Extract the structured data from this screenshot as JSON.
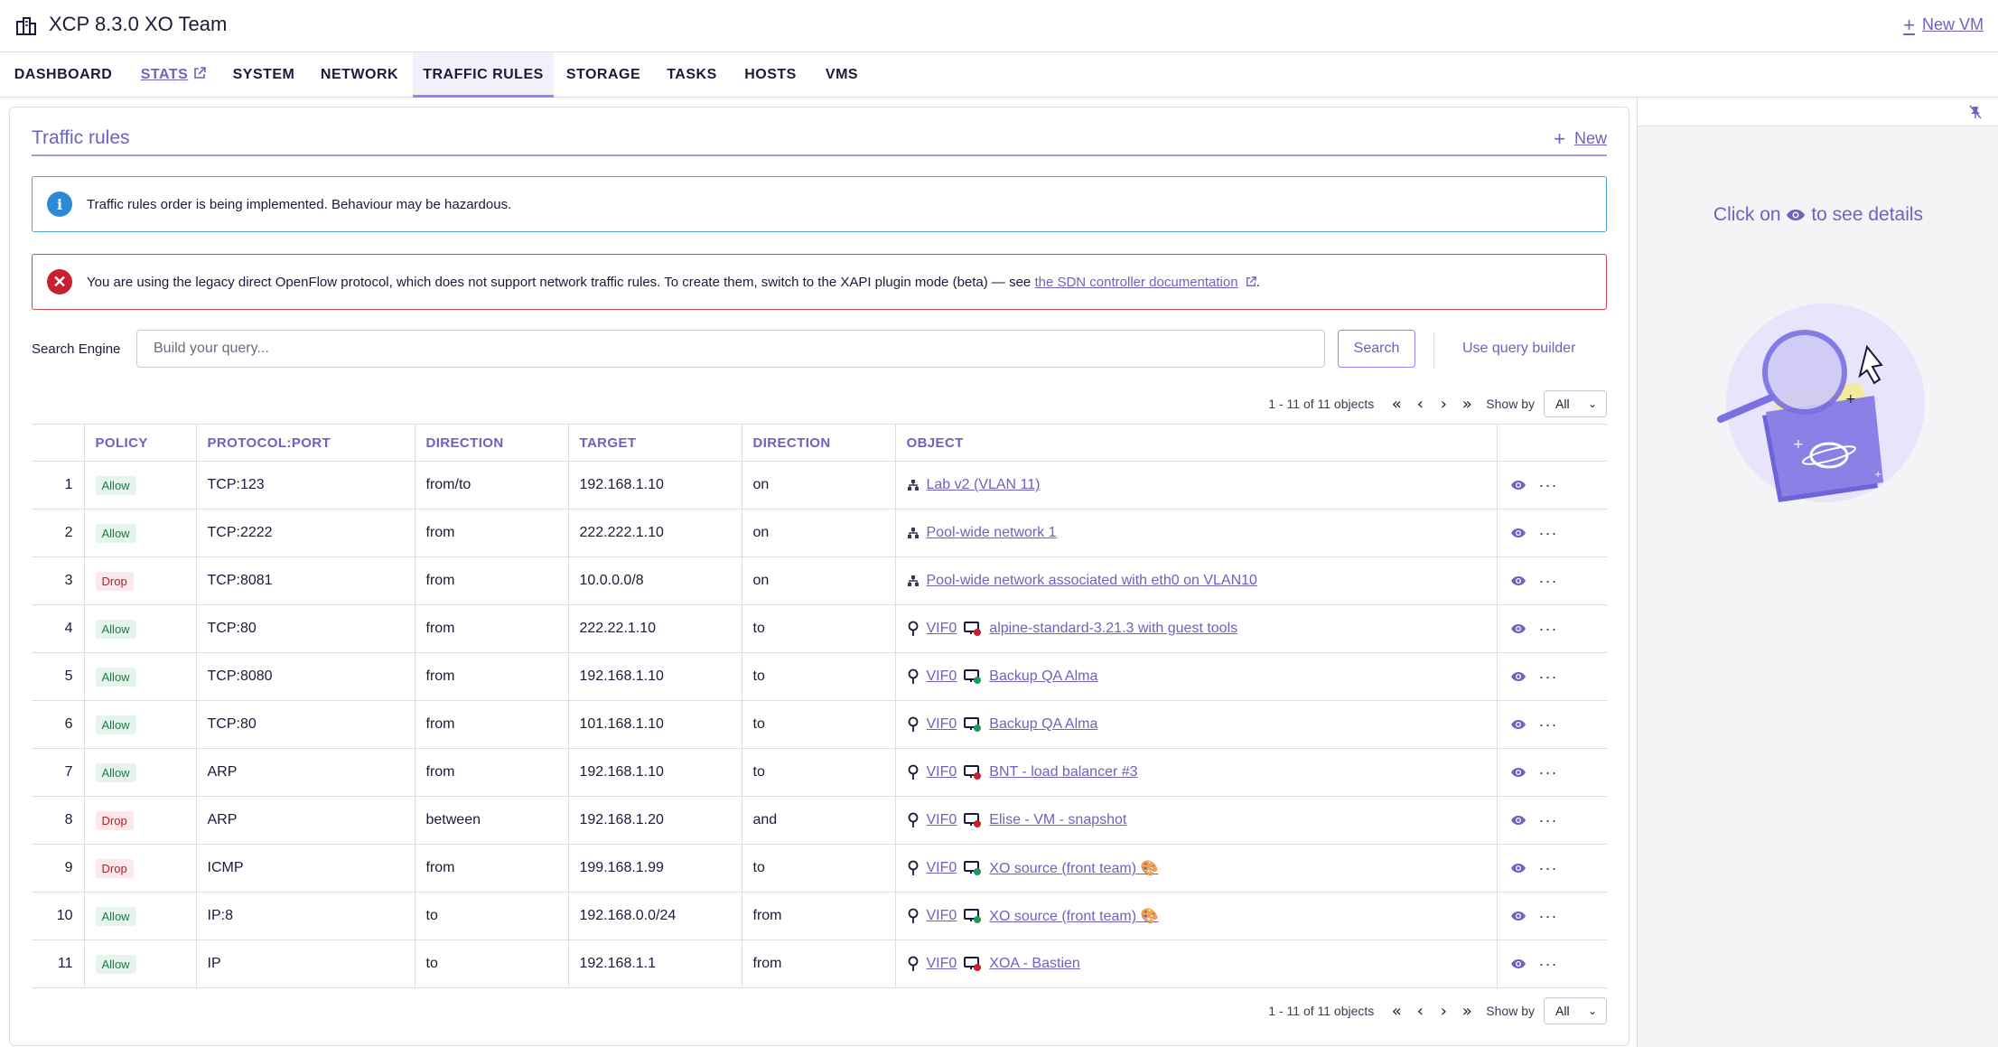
{
  "header": {
    "title": "XCP 8.3.0 XO Team",
    "new_vm": "New VM"
  },
  "tabs": [
    {
      "label": "DASHBOARD"
    },
    {
      "label": "STATS"
    },
    {
      "label": "SYSTEM"
    },
    {
      "label": "NETWORK"
    },
    {
      "label": "TRAFFIC RULES"
    },
    {
      "label": "STORAGE"
    },
    {
      "label": "TASKS"
    },
    {
      "label": "HOSTS"
    },
    {
      "label": "VMS"
    }
  ],
  "section": {
    "title": "Traffic rules",
    "new_label": "New"
  },
  "alerts": {
    "info": "Traffic rules order is being implemented. Behaviour may be hazardous.",
    "danger_text": "You are using the legacy direct OpenFlow protocol, which does not support network traffic rules. To create them, switch to the XAPI plugin mode (beta) — see",
    "danger_link": "the SDN controller documentation",
    "danger_end": "."
  },
  "search": {
    "label": "Search Engine",
    "placeholder": "Build your query...",
    "button": "Search",
    "query_builder": "Use query builder"
  },
  "pagination": {
    "count": "1 - 11 of 11 objects",
    "show_by_label": "Show by",
    "show_by_value": "All"
  },
  "table": {
    "columns": [
      "",
      "POLICY",
      "PROTOCOL:PORT",
      "DIRECTION",
      "TARGET",
      "DIRECTION",
      "OBJECT",
      ""
    ],
    "rows": [
      {
        "n": "1",
        "policy": "Allow",
        "proto": "TCP:123",
        "dir": "from/to",
        "target": "192.168.1.10",
        "dir2": "on",
        "obj_type": "network",
        "obj": "Lab v2 (VLAN 11)"
      },
      {
        "n": "2",
        "policy": "Allow",
        "proto": "TCP:2222",
        "dir": "from",
        "target": "222.222.1.10",
        "dir2": "on",
        "obj_type": "network",
        "obj": "Pool-wide network 1"
      },
      {
        "n": "3",
        "policy": "Drop",
        "proto": "TCP:8081",
        "dir": "from",
        "target": "10.0.0.0/8",
        "dir2": "on",
        "obj_type": "network",
        "obj": "Pool-wide network associated with eth0 on VLAN10"
      },
      {
        "n": "4",
        "policy": "Allow",
        "proto": "TCP:80",
        "dir": "from",
        "target": "222.22.1.10",
        "dir2": "to",
        "obj_type": "vif",
        "vif": "VIF0",
        "vm_state": "halted",
        "obj": "alpine-standard-3.21.3 with guest tools"
      },
      {
        "n": "5",
        "policy": "Allow",
        "proto": "TCP:8080",
        "dir": "from",
        "target": "192.168.1.10",
        "dir2": "to",
        "obj_type": "vif",
        "vif": "VIF0",
        "vm_state": "running",
        "obj": "Backup QA Alma"
      },
      {
        "n": "6",
        "policy": "Allow",
        "proto": "TCP:80",
        "dir": "from",
        "target": "101.168.1.10",
        "dir2": "to",
        "obj_type": "vif",
        "vif": "VIF0",
        "vm_state": "running",
        "obj": "Backup QA Alma"
      },
      {
        "n": "7",
        "policy": "Allow",
        "proto": "ARP",
        "dir": "from",
        "target": "192.168.1.10",
        "dir2": "to",
        "obj_type": "vif",
        "vif": "VIF0",
        "vm_state": "halted",
        "obj": "BNT - load balancer #3"
      },
      {
        "n": "8",
        "policy": "Drop",
        "proto": "ARP",
        "dir": "between",
        "target": "192.168.1.20",
        "dir2": "and",
        "obj_type": "vif",
        "vif": "VIF0",
        "vm_state": "halted",
        "obj": "Elise - VM - snapshot"
      },
      {
        "n": "9",
        "policy": "Drop",
        "proto": "ICMP",
        "dir": "from",
        "target": "199.168.1.99",
        "dir2": "to",
        "obj_type": "vif",
        "vif": "VIF0",
        "vm_state": "running",
        "obj": "XO source (front team) 🎨"
      },
      {
        "n": "10",
        "policy": "Allow",
        "proto": "IP:8",
        "dir": "to",
        "target": "192.168.0.0/24",
        "dir2": "from",
        "obj_type": "vif",
        "vif": "VIF0",
        "vm_state": "running",
        "obj": "XO source (front team) 🎨"
      },
      {
        "n": "11",
        "policy": "Allow",
        "proto": "IP",
        "dir": "to",
        "target": "192.168.1.1",
        "dir2": "from",
        "obj_type": "vif",
        "vif": "VIF0",
        "vm_state": "halted",
        "obj": "XOA - Bastien"
      }
    ]
  },
  "side_panel": {
    "msg_before": "Click on",
    "msg_after": "to see details"
  },
  "colors": {
    "accent": "#6b63bf",
    "allow_bg": "#e6f5ec",
    "allow_fg": "#1d7a48",
    "drop_bg": "#fce8ea",
    "drop_fg": "#b2202c",
    "info": "#2b8ad6",
    "danger": "#c8202e"
  }
}
